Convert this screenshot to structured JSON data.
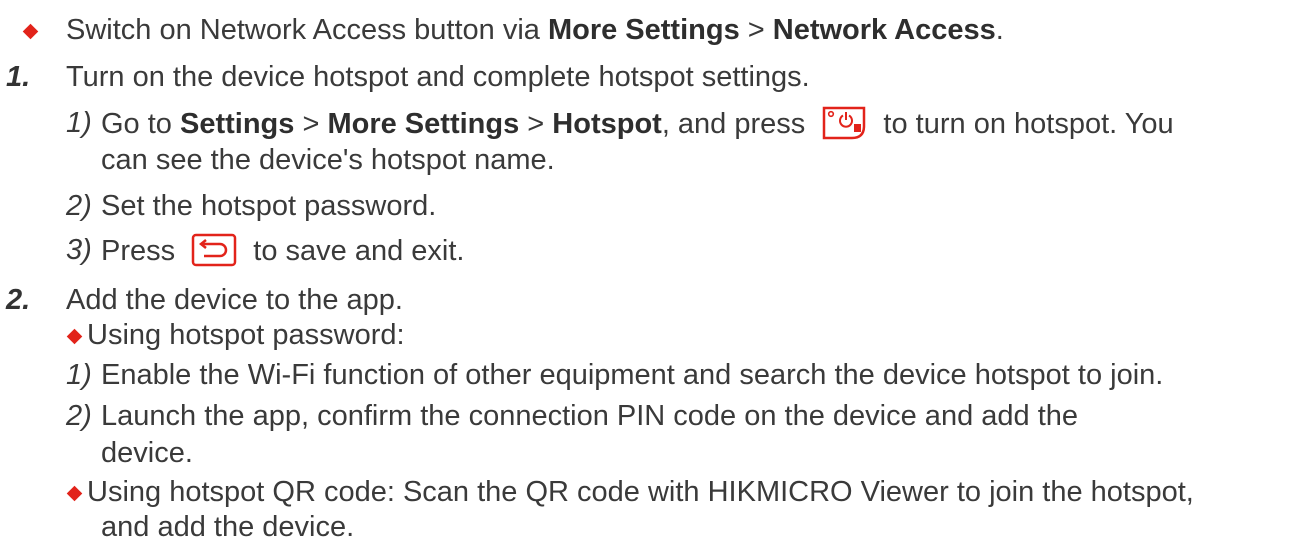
{
  "prereq": {
    "text_a": "Switch on Network Access button via ",
    "bold_a": "More Settings",
    "sep": " > ",
    "bold_b": "Network Access",
    "end": "."
  },
  "step1": {
    "num": "1.",
    "text": "Turn on the device hotspot and complete hotspot settings.",
    "sub1": {
      "num": "1)",
      "t1": "Go to ",
      "b1": "Settings",
      "sep1": " > ",
      "b2": "More Settings",
      "sep2": " > ",
      "b3": "Hotspot",
      "t2": ", and press",
      "t3": "to turn on hotspot. You",
      "t4": "can see the device's hotspot name.",
      "icon": "hotspot-power-icon"
    },
    "sub2": {
      "num": "2)",
      "text": "Set the hotspot password."
    },
    "sub3": {
      "num": "3)",
      "t1": "Press",
      "t2": "to save and exit.",
      "icon": "back-exit-icon"
    }
  },
  "step2": {
    "num": "2.",
    "text": "Add the device to the app.",
    "optA": {
      "label": "Using hotspot password:",
      "s1_num": "1)",
      "s1_text": "Enable the Wi-Fi function of other equipment and search the device hotspot to join.",
      "s2_num": "2)",
      "s2_text_l1": "Launch the app, confirm the connection PIN code on the device and add the",
      "s2_text_l2": "device."
    },
    "optB": {
      "text_l1": "Using hotspot QR code: Scan the QR code with HIKMICRO Viewer to join the hotspot,",
      "text_l2": "and add the device."
    }
  },
  "colors": {
    "accent": "#e2231a",
    "text": "#3a3a3a"
  }
}
